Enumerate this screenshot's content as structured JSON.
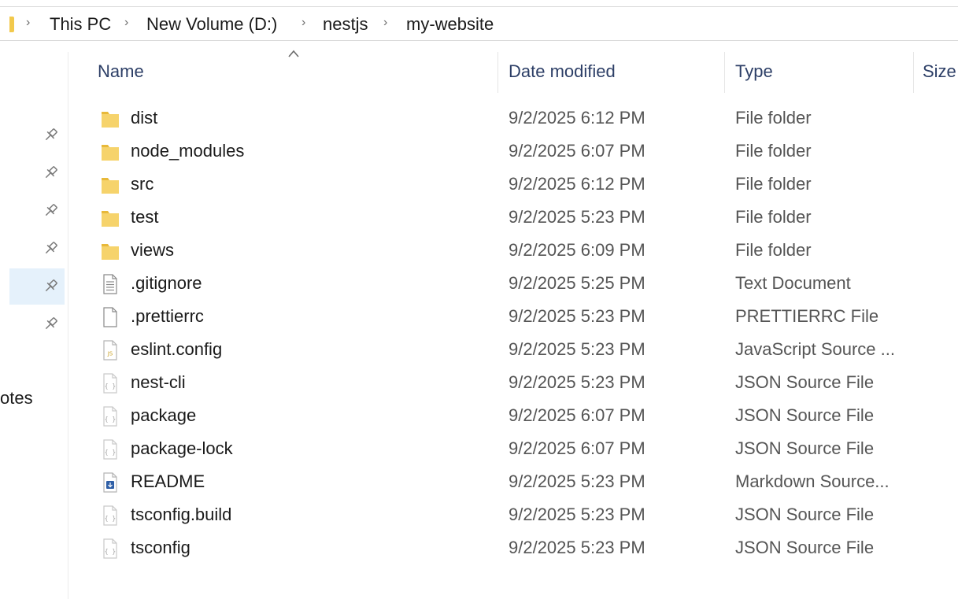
{
  "breadcrumb": {
    "items": [
      "This PC",
      "New Volume (D:)",
      "nestjs",
      "my-website"
    ],
    "separator": "›"
  },
  "columns": {
    "name": "Name",
    "date": "Date modified",
    "type": "Type",
    "size": "Size"
  },
  "sort": {
    "column": "name",
    "direction": "ascending",
    "icon": "sort-caret-up-icon"
  },
  "nav": {
    "pinned_count": 6,
    "selected_index": 4,
    "visible_label": "otes"
  },
  "files": [
    {
      "name": "dist",
      "date": "9/2/2025 6:12 PM",
      "type": "File folder",
      "icon": "folder-icon"
    },
    {
      "name": "node_modules",
      "date": "9/2/2025 6:07 PM",
      "type": "File folder",
      "icon": "folder-icon"
    },
    {
      "name": "src",
      "date": "9/2/2025 6:12 PM",
      "type": "File folder",
      "icon": "folder-icon"
    },
    {
      "name": "test",
      "date": "9/2/2025 5:23 PM",
      "type": "File folder",
      "icon": "folder-icon"
    },
    {
      "name": "views",
      "date": "9/2/2025 6:09 PM",
      "type": "File folder",
      "icon": "folder-icon"
    },
    {
      "name": ".gitignore",
      "date": "9/2/2025 5:25 PM",
      "type": "Text Document",
      "icon": "text-document-icon"
    },
    {
      "name": ".prettierrc",
      "date": "9/2/2025 5:23 PM",
      "type": "PRETTIERRC File",
      "icon": "blank-file-icon"
    },
    {
      "name": "eslint.config",
      "date": "9/2/2025 5:23 PM",
      "type": "JavaScript Source ...",
      "icon": "javascript-file-icon"
    },
    {
      "name": "nest-cli",
      "date": "9/2/2025 5:23 PM",
      "type": "JSON Source File",
      "icon": "json-file-icon"
    },
    {
      "name": "package",
      "date": "9/2/2025 6:07 PM",
      "type": "JSON Source File",
      "icon": "json-file-icon"
    },
    {
      "name": "package-lock",
      "date": "9/2/2025 6:07 PM",
      "type": "JSON Source File",
      "icon": "json-file-icon"
    },
    {
      "name": "README",
      "date": "9/2/2025 5:23 PM",
      "type": "Markdown Source...",
      "icon": "markdown-file-icon"
    },
    {
      "name": "tsconfig.build",
      "date": "9/2/2025 5:23 PM",
      "type": "JSON Source File",
      "icon": "json-file-icon"
    },
    {
      "name": "tsconfig",
      "date": "9/2/2025 5:23 PM",
      "type": "JSON Source File",
      "icon": "json-file-icon"
    }
  ],
  "colors": {
    "folder": "#f6d36b",
    "folder_tab": "#e8b93a",
    "header_text": "#2c3e66",
    "selection": "#e5f1fb",
    "js_badge": "#c9a227",
    "md_badge": "#2f5fa6"
  }
}
